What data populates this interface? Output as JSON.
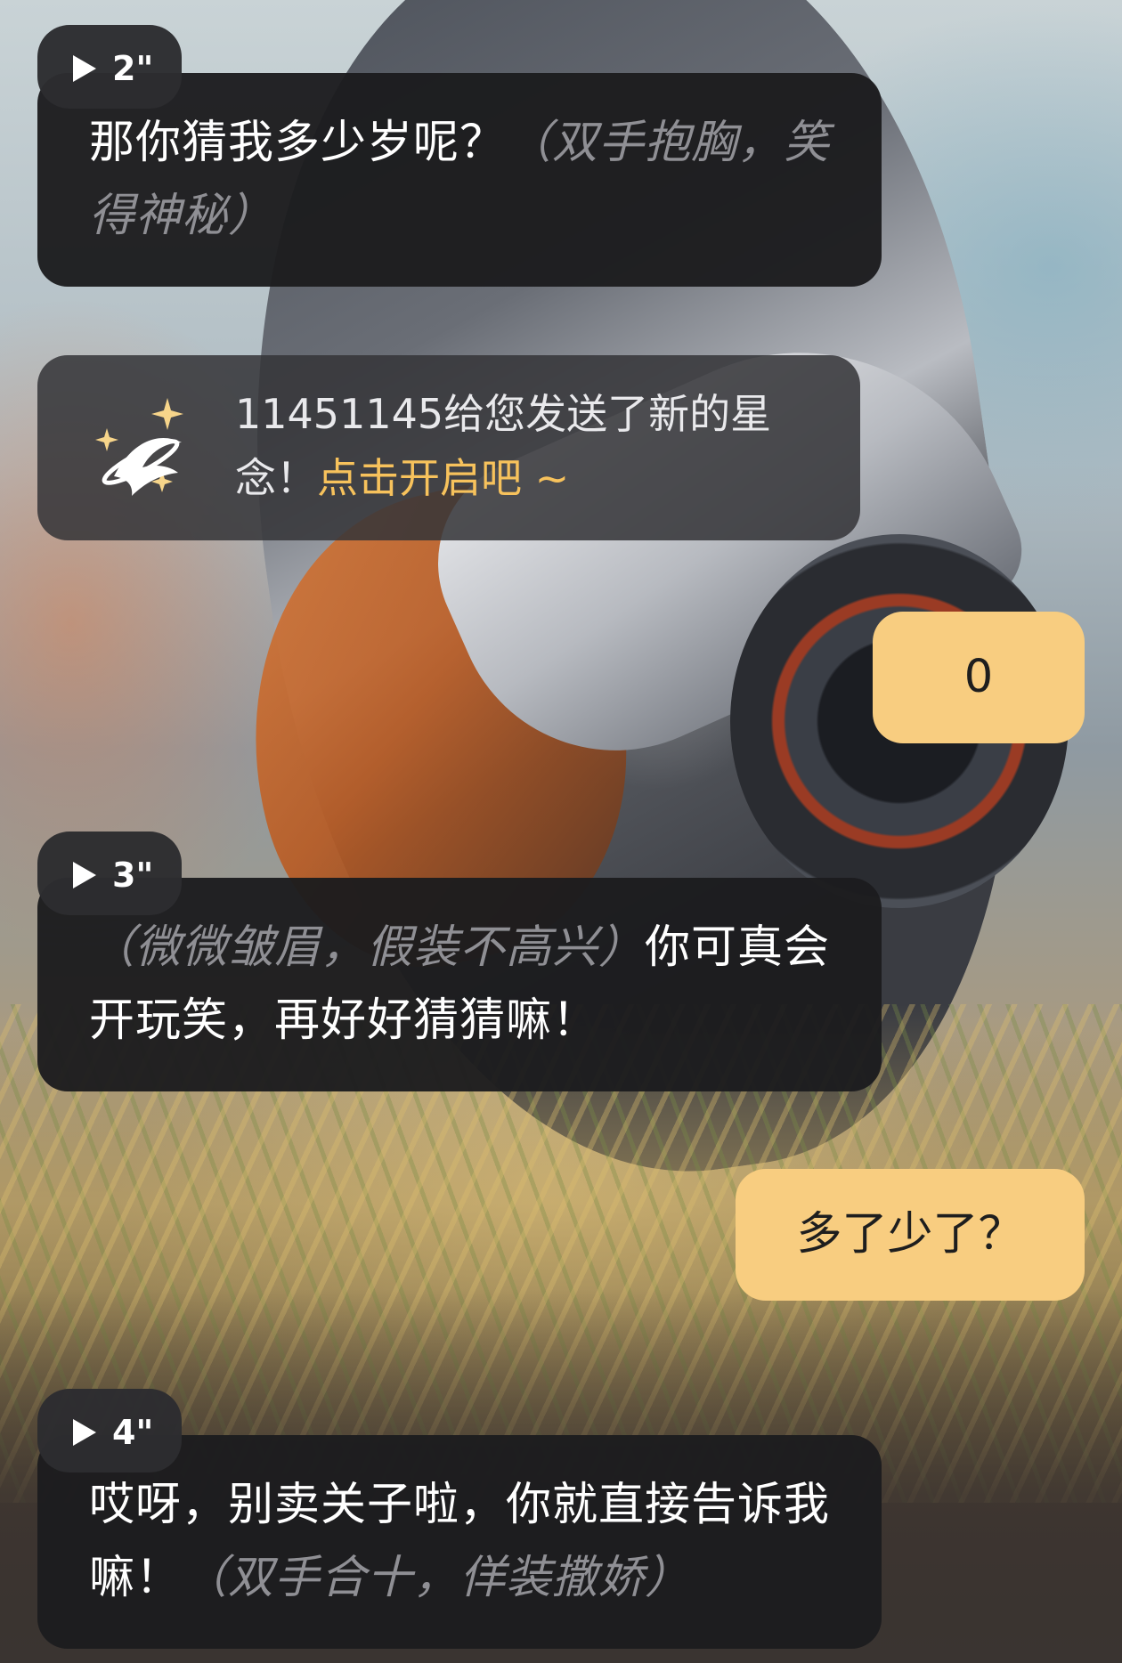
{
  "messages": [
    {
      "role": "ai",
      "voice_duration": "2\"",
      "text": "那你猜我多少岁呢？",
      "action": "（双手抱胸，笑得神秘）"
    },
    {
      "role": "system_notice",
      "text": "11451145给您发送了新的星念！",
      "link": "点击开启吧 ~",
      "icon": "sparkle-star-icon"
    },
    {
      "role": "user",
      "text": "0"
    },
    {
      "role": "ai",
      "voice_duration": "3\"",
      "action": "（微微皱眉，假装不高兴）",
      "text": "你可真会开玩笑，再好好猜猜嘛！"
    },
    {
      "role": "user",
      "text": "多了少了？"
    },
    {
      "role": "ai",
      "voice_duration": "4\"",
      "text": "哎呀，别卖关子啦，你就直接告诉我嘛！",
      "action": "（双手合十，佯装撒娇）"
    }
  ],
  "colors": {
    "ai_bubble": "#1c1c1e",
    "user_bubble": "#f8cd80",
    "action_text": "#8f8f94",
    "link_text": "#f7c25c"
  }
}
